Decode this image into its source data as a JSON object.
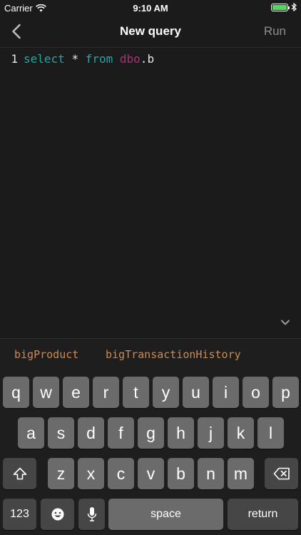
{
  "status_bar": {
    "carrier": "Carrier",
    "time": "9:10 AM",
    "battery_level": 1.0,
    "battery_color": "#4cd964",
    "wifi_icon": "wifi-icon",
    "bluetooth_icon": "bluetooth-icon"
  },
  "nav": {
    "back_icon": "chevron-left-icon",
    "title": "New query",
    "run_label": "Run"
  },
  "editor": {
    "line_number": "1",
    "tokens": {
      "keyword_select": "select",
      "star": "*",
      "keyword_from": "from",
      "schema": "dbo",
      "dot": ".",
      "partial": "b"
    },
    "colors": {
      "keyword": "#24a6a6",
      "schema": "#c2257e",
      "suggestion": "#cc8a54"
    },
    "collapse_icon": "chevron-down-icon"
  },
  "suggestions": [
    "bigProduct",
    "bigTransactionHistory"
  ],
  "keyboard": {
    "row1": [
      "q",
      "w",
      "e",
      "r",
      "t",
      "y",
      "u",
      "i",
      "o",
      "p"
    ],
    "row2": [
      "a",
      "s",
      "d",
      "f",
      "g",
      "h",
      "j",
      "k",
      "l"
    ],
    "row3": [
      "z",
      "x",
      "c",
      "v",
      "b",
      "n",
      "m"
    ],
    "shift_icon": "shift-icon",
    "delete_icon": "delete-icon",
    "numbers_label": "123",
    "emoji_icon": "emoji-icon",
    "mic_icon": "microphone-icon",
    "space_label": "space",
    "return_label": "return"
  }
}
